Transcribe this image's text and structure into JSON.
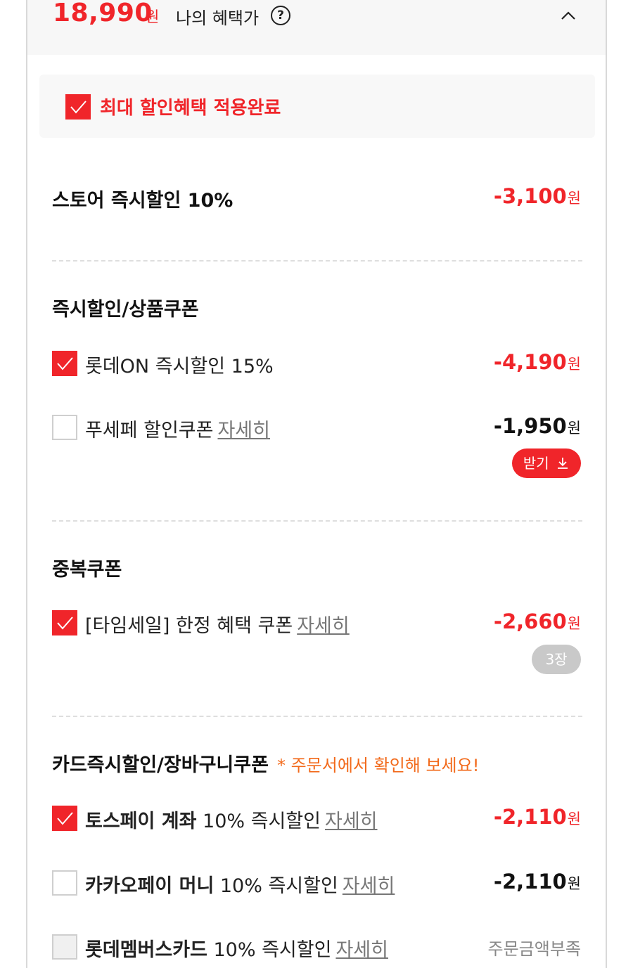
{
  "header": {
    "price": "18,990",
    "won": "원",
    "benefit_label": "나의 혜택가",
    "help": "?"
  },
  "max_benefit": {
    "label": "최대 할인혜택 적용완료",
    "checked": true
  },
  "store_discount": {
    "label": "스토어 즉시할인 10%",
    "amount": "-3,100",
    "won": "원"
  },
  "section_instant": {
    "title": "즉시할인/상품쿠폰",
    "items": [
      {
        "label": "롯데ON 즉시할인 15%",
        "amount": "-4,190",
        "won": "원",
        "checked": true
      },
      {
        "label": "푸세페 할인쿠폰",
        "more": "자세히",
        "amount": "-1,950",
        "won": "원",
        "checked": false,
        "button": "받기"
      }
    ]
  },
  "section_dup": {
    "title": "중복쿠폰",
    "items": [
      {
        "label": "[타임세일] 한정 혜택 쿠폰",
        "more": "자세히",
        "amount": "-2,660",
        "won": "원",
        "checked": true,
        "badge": "3장"
      }
    ]
  },
  "section_card": {
    "title": "카드즉시할인/장바구니쿠폰",
    "notice": "* 주문서에서 확인해 보세요!",
    "items": [
      {
        "bold": "토스페이 계좌",
        "label": " 10% 즉시할인",
        "more": "자세히",
        "amount": "-2,110",
        "won": "원",
        "checked": true
      },
      {
        "bold": "카카오페이 머니",
        "label": " 10% 즉시할인",
        "more": "자세히",
        "amount": "-2,110",
        "won": "원",
        "checked": false
      },
      {
        "bold": "롯데멤버스카드",
        "label": " 10% 즉시할인",
        "more": "자세히",
        "status": "주문금액부족",
        "checked": false
      }
    ]
  },
  "colors": {
    "accent": "#f0252a",
    "notice": "#f26a1b",
    "muted": "#777777"
  }
}
